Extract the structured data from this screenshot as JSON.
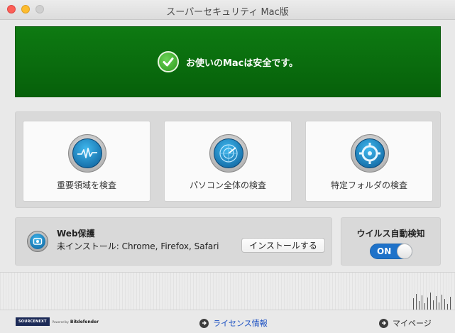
{
  "window": {
    "title": "スーパーセキュリティ Mac版"
  },
  "status": {
    "message": "お使いのMacは安全です。",
    "color": "#0b7010"
  },
  "scan": {
    "items": [
      {
        "label": "重要領域を検査",
        "icon": "pulse-icon"
      },
      {
        "label": "パソコン全体の検査",
        "icon": "radar-icon"
      },
      {
        "label": "特定フォルダの検査",
        "icon": "target-icon"
      }
    ]
  },
  "web_protection": {
    "title": "Web保護",
    "status": "未インストール: Chrome, Firefox, Safari",
    "install_label": "インストールする",
    "icon": "camera-shield-icon"
  },
  "auto_detect": {
    "title": "ウイルス自動検知",
    "toggle_label": "ON",
    "toggle_color": "#1e72c9"
  },
  "footer": {
    "brand": {
      "name": "SOURCENEXT",
      "powered": "Powered by",
      "partner": "Bitdefender"
    },
    "license_label": "ライセンス情報",
    "mypage_label": "マイページ"
  }
}
